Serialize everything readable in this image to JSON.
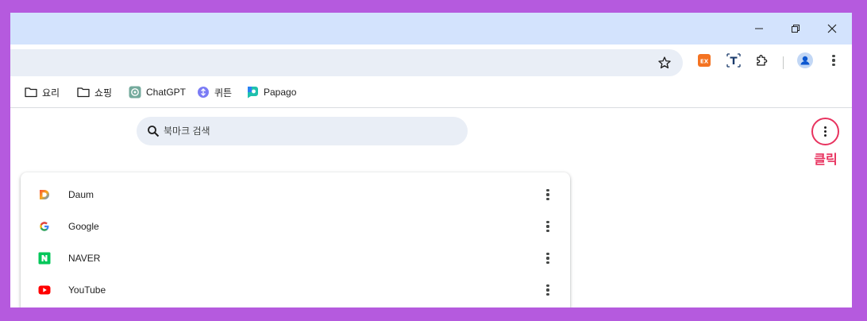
{
  "bookmarks_bar": {
    "items": [
      {
        "label": "요리",
        "icon": "folder-icon"
      },
      {
        "label": "쇼핑",
        "icon": "folder-icon"
      },
      {
        "label": "ChatGPT",
        "icon": "chatgpt-icon"
      },
      {
        "label": "퀴튼",
        "icon": "wrtn-icon"
      },
      {
        "label": "Papago",
        "icon": "papago-icon"
      }
    ]
  },
  "bookmark_manager": {
    "search_placeholder": "북마크 검색",
    "annotation": "클릭",
    "items": [
      {
        "title": "Daum",
        "icon": "daum-icon"
      },
      {
        "title": "Google",
        "icon": "google-icon"
      },
      {
        "title": "NAVER",
        "icon": "naver-icon"
      },
      {
        "title": "YouTube",
        "icon": "youtube-icon"
      }
    ]
  },
  "colors": {
    "frame_background": "#b55ade",
    "titlebar": "#d3e3fd",
    "omnibox": "#e9eef6",
    "annotation": "#e8335f"
  }
}
